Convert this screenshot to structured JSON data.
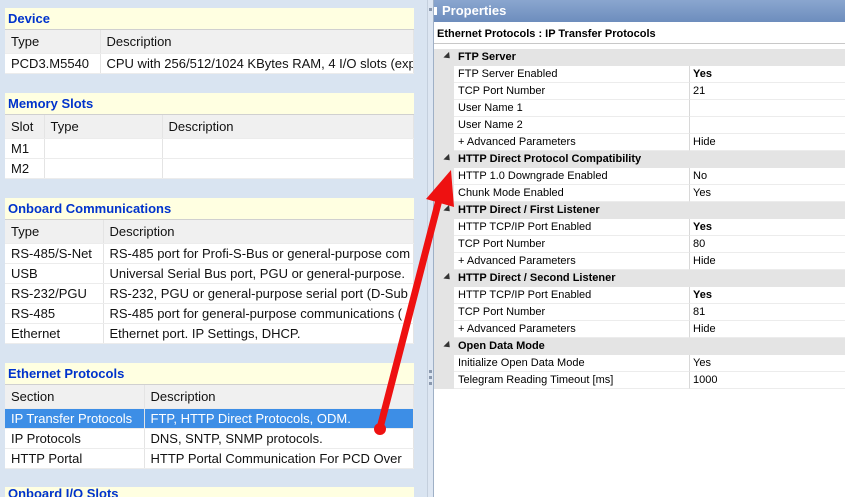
{
  "device": {
    "title": "Device",
    "headers": [
      "Type",
      "Description"
    ],
    "rows": [
      [
        "PCD3.M5540",
        "CPU with 256/512/1024 KBytes RAM, 4 I/O slots (exp"
      ]
    ]
  },
  "memory_slots": {
    "title": "Memory Slots",
    "headers": [
      "Slot",
      "Type",
      "Description"
    ],
    "rows": [
      [
        "M1",
        "",
        ""
      ],
      [
        "M2",
        "",
        ""
      ]
    ]
  },
  "onboard_comms": {
    "title": "Onboard Communications",
    "headers": [
      "Type",
      "Description"
    ],
    "rows": [
      [
        "RS-485/S-Net",
        "RS-485 port for Profi-S-Bus or general-purpose com"
      ],
      [
        "USB",
        "Universal Serial Bus port, PGU or general-purpose."
      ],
      [
        "RS-232/PGU",
        "RS-232, PGU or general-purpose serial port (D-Sub"
      ],
      [
        "RS-485",
        "RS-485 port for general-purpose communications ("
      ],
      [
        "Ethernet",
        "Ethernet port. IP Settings, DHCP."
      ]
    ]
  },
  "ethernet_protocols": {
    "title": "Ethernet Protocols",
    "headers": [
      "Section",
      "Description"
    ],
    "rows": [
      [
        "IP Transfer Protocols",
        "FTP, HTTP Direct Protocols, ODM."
      ],
      [
        "IP Protocols",
        "DNS, SNTP, SNMP protocols."
      ],
      [
        "HTTP Portal",
        "HTTP Portal Communication For PCD Over"
      ]
    ],
    "selected_row": 0
  },
  "onboard_io": {
    "title": "Onboard I/O Slots"
  },
  "properties": {
    "title": "Properties",
    "subtitle": "Ethernet Protocols : IP Transfer Protocols",
    "categories": [
      {
        "name": "FTP Server",
        "rows": [
          {
            "name": "FTP Server Enabled",
            "value": "Yes",
            "bold": true
          },
          {
            "name": "TCP Port Number",
            "value": "21",
            "bold": false
          },
          {
            "name": "User Name 1",
            "value": "",
            "bold": false
          },
          {
            "name": "User Name 2",
            "value": "",
            "bold": false
          },
          {
            "name": "+ Advanced Parameters",
            "value": "Hide",
            "bold": false
          }
        ]
      },
      {
        "name": "HTTP Direct Protocol Compatibility",
        "rows": [
          {
            "name": "HTTP 1.0 Downgrade Enabled",
            "value": "No",
            "bold": false
          },
          {
            "name": "Chunk Mode Enabled",
            "value": "Yes",
            "bold": false
          }
        ]
      },
      {
        "name": "HTTP Direct / First Listener",
        "rows": [
          {
            "name": "HTTP TCP/IP Port Enabled",
            "value": "Yes",
            "bold": true
          },
          {
            "name": "TCP Port Number",
            "value": "80",
            "bold": false
          },
          {
            "name": "+ Advanced Parameters",
            "value": "Hide",
            "bold": false
          }
        ]
      },
      {
        "name": "HTTP Direct / Second Listener",
        "rows": [
          {
            "name": "HTTP TCP/IP Port Enabled",
            "value": "Yes",
            "bold": true
          },
          {
            "name": "TCP Port Number",
            "value": "81",
            "bold": false
          },
          {
            "name": "+ Advanced Parameters",
            "value": "Hide",
            "bold": false
          }
        ]
      },
      {
        "name": "Open Data Mode",
        "rows": [
          {
            "name": "Initialize Open Data Mode",
            "value": "Yes",
            "bold": false
          },
          {
            "name": "Telegram Reading Timeout [ms]",
            "value": "1000",
            "bold": false
          }
        ]
      }
    ]
  },
  "colors": {
    "header_text": "#0033cc",
    "header_bg": "#ffffe1",
    "selection": "#3d8ee6",
    "arrow": "#ee1111"
  }
}
